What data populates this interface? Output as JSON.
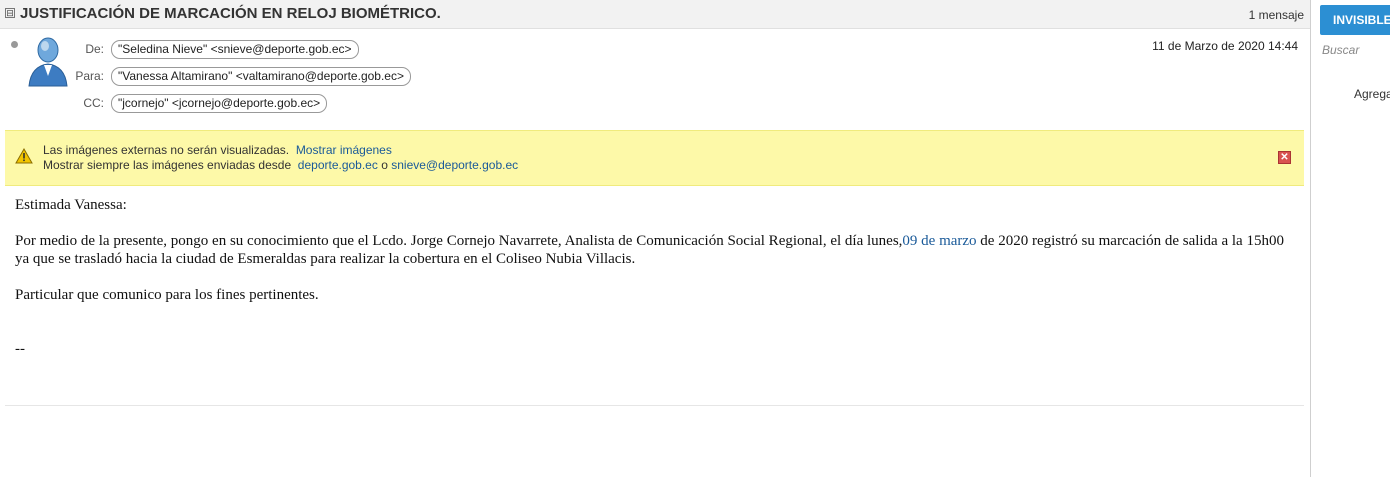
{
  "header": {
    "subject": "JUSTIFICACIÓN DE MARCACIÓN EN RELOJ BIOMÉTRICO.",
    "count": "1 mensaje",
    "collapse_glyph": "⊟"
  },
  "message": {
    "from_label": "De:",
    "from": "\"Seledina Nieve\" <snieve@deporte.gob.ec>",
    "to_label": "Para:",
    "to": "\"Vanessa Altamirano\" <valtamirano@deporte.gob.ec>",
    "cc_label": "CC:",
    "cc": "\"jcornejo\" <jcornejo@deporte.gob.ec>",
    "date": "11 de Marzo de 2020 14:44"
  },
  "warning": {
    "line1_text": "Las imágenes externas no serán visualizadas.",
    "show_images": "Mostrar imágenes",
    "line2_text": "Mostrar siempre las imágenes enviadas desde",
    "domain_link": "deporte.gob.ec",
    "or": "o",
    "sender_link": "snieve@deporte.gob.ec",
    "close_glyph": "✕"
  },
  "body": {
    "greeting": "Estimada Vanessa:",
    "p1_before": "Por medio de la presente, pongo en su conocimiento que el Lcdo. Jorge Cornejo Navarrete, Analista de Comunicación Social Regional, el día lunes,",
    "p1_link": "09 de marzo",
    "p1_after": " de 2020 registró su marcación de salida a la 15h00 ya que se trasladó hacia la ciudad de Esmeraldas para realizar la cobertura en el Coliseo Nubia Villacis.",
    "p2": "Particular que comunico para los fines pertinentes.",
    "signature": "--"
  },
  "sidebar": {
    "invisible_button": "INVISIBLE",
    "search_placeholder": "Buscar",
    "add_label": "Agrega"
  },
  "colors": {
    "accent": "#2c8fd3",
    "link": "#1a5a99",
    "warning_bg": "#fdf9a8"
  }
}
